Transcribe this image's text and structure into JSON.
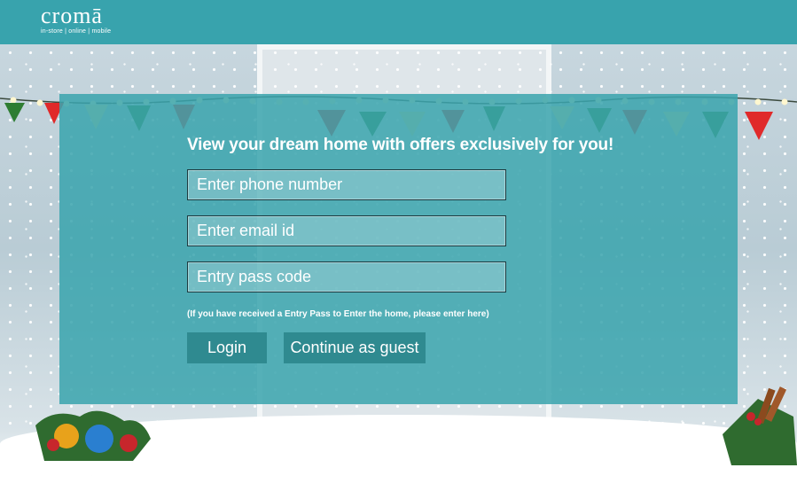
{
  "header": {
    "logo_word": "cromā",
    "logo_tagline": "in-store | online | mobile"
  },
  "form": {
    "headline": "View your dream home with offers exclusively for you!",
    "phone_placeholder": "Enter phone number",
    "email_placeholder": "Enter email id",
    "pass_placeholder": "Entry pass code",
    "hint": "(If you have received a Entry Pass to Enter the home, please enter here)",
    "login_label": "Login",
    "guest_label": "Continue as guest"
  },
  "colors": {
    "brand_teal": "#38a3ad",
    "panel": "#3aa4ae",
    "button": "#2f8a90",
    "bunting": [
      "#e02a2a",
      "#2e7d32",
      "#f5e6a8"
    ]
  }
}
